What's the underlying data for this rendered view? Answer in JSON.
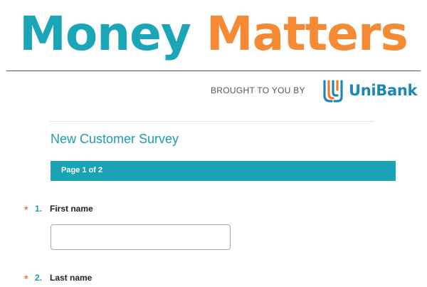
{
  "brand": {
    "title_word_1": "Money",
    "title_word_2": "Matters",
    "title_color_1": "#1aa6b7",
    "title_color_2": "#f58a34"
  },
  "sponsor": {
    "label": "BROUGHT TO YOU BY",
    "bank_name": "UniBank",
    "bank_color": "#1c87b6",
    "bank_icon": "unibank-logo-icon"
  },
  "survey": {
    "title": "New Customer Survey",
    "accent_color": "#19a3b4",
    "page_indicator": "Page 1 of 2"
  },
  "questions": [
    {
      "required_marker": "*",
      "number": "1.",
      "label": "First name",
      "value": "",
      "placeholder": ""
    },
    {
      "required_marker": "*",
      "number": "2.",
      "label": "Last name"
    }
  ]
}
